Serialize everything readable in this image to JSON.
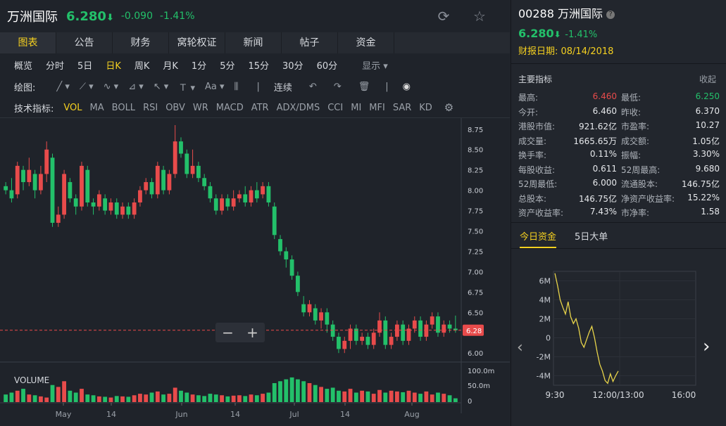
{
  "header": {
    "name": "万洲国际",
    "price": "6.280",
    "arrow": "⬇",
    "change": "-0.090",
    "change_pct": "-1.41%",
    "refresh_icon": "refresh-icon",
    "star_icon": "star-icon"
  },
  "tabs": [
    "图表",
    "公告",
    "财务",
    "窝轮权证",
    "新闻",
    "帖子",
    "资金"
  ],
  "periods": [
    "概览",
    "分时",
    "5日",
    "日K",
    "周K",
    "月K",
    "1分",
    "5分",
    "15分",
    "30分",
    "60分",
    "显示"
  ],
  "active_period": "日K",
  "draw": {
    "label": "绘图:",
    "continuous": "连续"
  },
  "indicators": {
    "label": "技术指标:",
    "items": [
      "VOL",
      "MA",
      "BOLL",
      "RSI",
      "OBV",
      "WR",
      "MACD",
      "ATR",
      "ADX/DMS",
      "CCI",
      "MI",
      "MFI",
      "SAR",
      "KD"
    ],
    "active": "VOL"
  },
  "price_axis": [
    "8.75",
    "8.50",
    "8.25",
    "8.00",
    "7.75",
    "7.50",
    "7.25",
    "7.00",
    "6.75",
    "6.50",
    "6.25",
    "6.00"
  ],
  "current_price_tag": "6.28",
  "volume": {
    "label": "VOLUME",
    "axis": [
      "100.0m",
      "50.0m",
      "0"
    ]
  },
  "date_axis": [
    "May",
    "14",
    "Jun",
    "14",
    "Jul",
    "14",
    "Aug"
  ],
  "colors": {
    "up": "#e84b4b",
    "down": "#23c06a",
    "accent": "#f5d020",
    "line": "#e8d44a"
  },
  "right": {
    "title": "00288 万洲国际",
    "price": "6.280",
    "arrow": "⬇",
    "change_pct": "-1.41%",
    "report_date": "财报日期: 08/14/2018",
    "metrics_title": "主要指标",
    "collapse": "收起",
    "metrics": [
      [
        "最高:",
        "6.460",
        "最低:",
        "6.250"
      ],
      [
        "今开:",
        "6.460",
        "昨收:",
        "6.370"
      ],
      [
        "港股市值:",
        "921.62亿",
        "市盈率:",
        "10.27"
      ],
      [
        "成交量:",
        "1665.65万",
        "成交额:",
        "1.05亿"
      ],
      [
        "换手率:",
        "0.11%",
        "振幅:",
        "3.30%"
      ],
      [
        "每股收益:",
        "0.611",
        "52周最高:",
        "9.680"
      ],
      [
        "52周最低:",
        "6.000",
        "流通股本:",
        "146.75亿"
      ],
      [
        "总股本:",
        "146.75亿",
        "净资产收益率:",
        "15.22%"
      ],
      [
        "资产收益率:",
        "7.43%",
        "市净率:",
        "1.58"
      ]
    ],
    "fund_tabs": [
      "今日资金",
      "5日大单"
    ],
    "fund_y": [
      "6M",
      "4M",
      "2M",
      "0",
      "-2M",
      "-4M"
    ],
    "fund_x": [
      "9:30",
      "12:00/13:00",
      "16:00"
    ]
  },
  "chart_data": {
    "type": "candlestick",
    "price_range": [
      6.0,
      8.8
    ],
    "candles": [
      [
        8.05,
        8.0,
        8.1,
        7.95
      ],
      [
        8.0,
        7.9,
        8.15,
        7.85
      ],
      [
        7.95,
        8.3,
        8.35,
        7.9
      ],
      [
        8.25,
        8.1,
        8.3,
        8.0
      ],
      [
        8.1,
        8.25,
        8.4,
        8.05
      ],
      [
        8.2,
        8.0,
        8.25,
        7.9
      ],
      [
        8.0,
        8.2,
        8.3,
        7.95
      ],
      [
        8.2,
        8.5,
        8.6,
        8.1
      ],
      [
        8.4,
        7.6,
        8.45,
        7.55
      ],
      [
        7.6,
        7.7,
        7.8,
        7.55
      ],
      [
        7.7,
        8.2,
        8.25,
        7.65
      ],
      [
        8.1,
        7.9,
        8.15,
        7.85
      ],
      [
        7.9,
        7.8,
        7.95,
        7.7
      ],
      [
        7.8,
        8.3,
        8.35,
        7.75
      ],
      [
        8.25,
        7.85,
        8.3,
        7.8
      ],
      [
        7.85,
        7.8,
        7.9,
        7.7
      ],
      [
        7.8,
        7.95,
        8.0,
        7.75
      ],
      [
        7.9,
        7.75,
        7.95,
        7.7
      ],
      [
        7.75,
        7.85,
        7.9,
        7.7
      ],
      [
        7.85,
        7.7,
        7.9,
        7.65
      ],
      [
        7.7,
        7.8,
        7.85,
        7.65
      ],
      [
        7.8,
        7.7,
        7.85,
        7.65
      ],
      [
        7.7,
        7.85,
        7.9,
        7.65
      ],
      [
        7.85,
        8.0,
        8.05,
        7.8
      ],
      [
        8.0,
        8.1,
        8.15,
        7.95
      ],
      [
        8.1,
        7.95,
        8.15,
        7.9
      ],
      [
        7.95,
        8.3,
        8.35,
        7.9
      ],
      [
        8.25,
        8.0,
        8.3,
        7.95
      ],
      [
        8.0,
        8.2,
        8.25,
        7.95
      ],
      [
        8.2,
        8.6,
        8.8,
        8.15
      ],
      [
        8.6,
        8.45,
        8.65,
        8.4
      ],
      [
        8.45,
        8.2,
        8.5,
        8.15
      ],
      [
        8.2,
        8.3,
        8.5,
        8.15
      ],
      [
        8.3,
        8.15,
        8.35,
        8.1
      ],
      [
        8.15,
        8.05,
        8.2,
        8.0
      ],
      [
        8.05,
        7.9,
        8.1,
        7.85
      ],
      [
        7.9,
        7.75,
        7.95,
        7.7
      ],
      [
        7.75,
        7.9,
        7.95,
        7.7
      ],
      [
        7.9,
        7.8,
        7.95,
        7.75
      ],
      [
        7.8,
        7.9,
        8.0,
        7.75
      ],
      [
        7.9,
        7.95,
        8.0,
        7.85
      ],
      [
        7.95,
        7.85,
        8.05,
        7.8
      ],
      [
        7.85,
        8.0,
        8.05,
        7.8
      ],
      [
        8.0,
        7.9,
        8.1,
        7.85
      ],
      [
        7.95,
        8.05,
        8.1,
        7.9
      ],
      [
        8.05,
        7.85,
        8.1,
        7.8
      ],
      [
        7.8,
        7.45,
        7.85,
        7.4
      ],
      [
        7.4,
        7.25,
        7.45,
        7.2
      ],
      [
        7.25,
        7.15,
        7.3,
        7.05
      ],
      [
        7.15,
        6.95,
        7.2,
        6.9
      ],
      [
        6.95,
        6.75,
        7.0,
        6.7
      ],
      [
        6.6,
        6.5,
        6.7,
        6.45
      ],
      [
        6.5,
        6.6,
        6.65,
        6.45
      ],
      [
        6.55,
        6.4,
        6.6,
        6.35
      ],
      [
        6.4,
        6.5,
        6.55,
        6.3
      ],
      [
        6.5,
        6.35,
        6.55,
        6.25
      ],
      [
        6.35,
        6.2,
        6.4,
        6.15
      ],
      [
        6.2,
        6.05,
        6.25,
        6.0
      ],
      [
        6.05,
        6.15,
        6.2,
        6.0
      ],
      [
        6.15,
        6.3,
        6.35,
        6.05
      ],
      [
        6.3,
        6.15,
        6.35,
        6.1
      ],
      [
        6.15,
        6.2,
        6.25,
        6.1
      ],
      [
        6.2,
        6.1,
        6.25,
        6.05
      ],
      [
        6.1,
        6.25,
        6.3,
        6.05
      ],
      [
        6.25,
        6.4,
        6.5,
        6.2
      ],
      [
        6.4,
        6.1,
        6.45,
        6.05
      ],
      [
        6.1,
        6.2,
        6.25,
        6.05
      ],
      [
        6.2,
        6.35,
        6.4,
        6.15
      ],
      [
        6.35,
        6.15,
        6.4,
        6.1
      ],
      [
        6.15,
        6.3,
        6.35,
        6.1
      ],
      [
        6.3,
        6.4,
        6.45,
        6.25
      ],
      [
        6.4,
        6.2,
        6.45,
        6.15
      ],
      [
        6.2,
        6.35,
        6.4,
        6.15
      ],
      [
        6.35,
        6.45,
        6.5,
        6.3
      ],
      [
        6.45,
        6.25,
        6.5,
        6.2
      ],
      [
        6.25,
        6.35,
        6.4,
        6.2
      ],
      [
        6.35,
        6.3,
        6.4,
        6.25
      ],
      [
        6.3,
        6.28,
        6.46,
        6.25
      ]
    ],
    "volumes": [
      20,
      25,
      30,
      35,
      20,
      18,
      15,
      12,
      45,
      40,
      55,
      30,
      25,
      35,
      20,
      18,
      15,
      14,
      12,
      16,
      15,
      14,
      18,
      22,
      20,
      25,
      28,
      20,
      22,
      38,
      30,
      25,
      20,
      18,
      16,
      22,
      20,
      18,
      15,
      17,
      18,
      16,
      20,
      18,
      22,
      25,
      50,
      55,
      60,
      65,
      60,
      55,
      50,
      45,
      40,
      35,
      38,
      30,
      28,
      35,
      25,
      30,
      28,
      22,
      32,
      25,
      30,
      28,
      26,
      30,
      25,
      22,
      28,
      20,
      25,
      22,
      18,
      10
    ],
    "fund_flow": [
      6.8,
      5.5,
      4.0,
      3.2,
      2.5,
      3.8,
      2.2,
      1.5,
      2.0,
      1.0,
      -0.5,
      -1.0,
      -0.2,
      0.6,
      1.2,
      0.0,
      -1.5,
      -2.8,
      -3.5,
      -4.5,
      -4.8,
      -3.8,
      -4.6,
      -4.0,
      -3.5
    ]
  }
}
